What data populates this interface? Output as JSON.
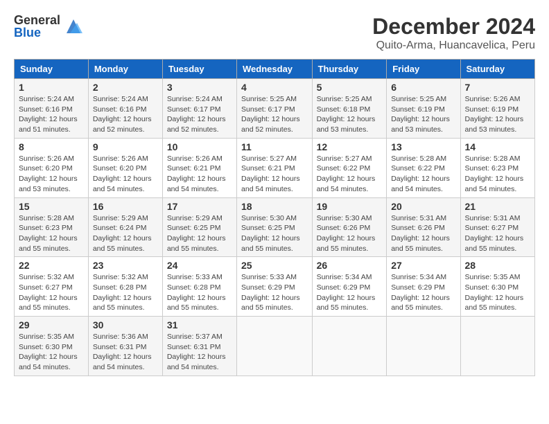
{
  "header": {
    "logo_general": "General",
    "logo_blue": "Blue",
    "title": "December 2024",
    "subtitle": "Quito-Arma, Huancavelica, Peru"
  },
  "calendar": {
    "days_of_week": [
      "Sunday",
      "Monday",
      "Tuesday",
      "Wednesday",
      "Thursday",
      "Friday",
      "Saturday"
    ],
    "weeks": [
      [
        {
          "day": "1",
          "info": "Sunrise: 5:24 AM\nSunset: 6:16 PM\nDaylight: 12 hours\nand 51 minutes."
        },
        {
          "day": "2",
          "info": "Sunrise: 5:24 AM\nSunset: 6:16 PM\nDaylight: 12 hours\nand 52 minutes."
        },
        {
          "day": "3",
          "info": "Sunrise: 5:24 AM\nSunset: 6:17 PM\nDaylight: 12 hours\nand 52 minutes."
        },
        {
          "day": "4",
          "info": "Sunrise: 5:25 AM\nSunset: 6:17 PM\nDaylight: 12 hours\nand 52 minutes."
        },
        {
          "day": "5",
          "info": "Sunrise: 5:25 AM\nSunset: 6:18 PM\nDaylight: 12 hours\nand 53 minutes."
        },
        {
          "day": "6",
          "info": "Sunrise: 5:25 AM\nSunset: 6:19 PM\nDaylight: 12 hours\nand 53 minutes."
        },
        {
          "day": "7",
          "info": "Sunrise: 5:26 AM\nSunset: 6:19 PM\nDaylight: 12 hours\nand 53 minutes."
        }
      ],
      [
        {
          "day": "8",
          "info": "Sunrise: 5:26 AM\nSunset: 6:20 PM\nDaylight: 12 hours\nand 53 minutes."
        },
        {
          "day": "9",
          "info": "Sunrise: 5:26 AM\nSunset: 6:20 PM\nDaylight: 12 hours\nand 54 minutes."
        },
        {
          "day": "10",
          "info": "Sunrise: 5:26 AM\nSunset: 6:21 PM\nDaylight: 12 hours\nand 54 minutes."
        },
        {
          "day": "11",
          "info": "Sunrise: 5:27 AM\nSunset: 6:21 PM\nDaylight: 12 hours\nand 54 minutes."
        },
        {
          "day": "12",
          "info": "Sunrise: 5:27 AM\nSunset: 6:22 PM\nDaylight: 12 hours\nand 54 minutes."
        },
        {
          "day": "13",
          "info": "Sunrise: 5:28 AM\nSunset: 6:22 PM\nDaylight: 12 hours\nand 54 minutes."
        },
        {
          "day": "14",
          "info": "Sunrise: 5:28 AM\nSunset: 6:23 PM\nDaylight: 12 hours\nand 54 minutes."
        }
      ],
      [
        {
          "day": "15",
          "info": "Sunrise: 5:28 AM\nSunset: 6:23 PM\nDaylight: 12 hours\nand 55 minutes."
        },
        {
          "day": "16",
          "info": "Sunrise: 5:29 AM\nSunset: 6:24 PM\nDaylight: 12 hours\nand 55 minutes."
        },
        {
          "day": "17",
          "info": "Sunrise: 5:29 AM\nSunset: 6:25 PM\nDaylight: 12 hours\nand 55 minutes."
        },
        {
          "day": "18",
          "info": "Sunrise: 5:30 AM\nSunset: 6:25 PM\nDaylight: 12 hours\nand 55 minutes."
        },
        {
          "day": "19",
          "info": "Sunrise: 5:30 AM\nSunset: 6:26 PM\nDaylight: 12 hours\nand 55 minutes."
        },
        {
          "day": "20",
          "info": "Sunrise: 5:31 AM\nSunset: 6:26 PM\nDaylight: 12 hours\nand 55 minutes."
        },
        {
          "day": "21",
          "info": "Sunrise: 5:31 AM\nSunset: 6:27 PM\nDaylight: 12 hours\nand 55 minutes."
        }
      ],
      [
        {
          "day": "22",
          "info": "Sunrise: 5:32 AM\nSunset: 6:27 PM\nDaylight: 12 hours\nand 55 minutes."
        },
        {
          "day": "23",
          "info": "Sunrise: 5:32 AM\nSunset: 6:28 PM\nDaylight: 12 hours\nand 55 minutes."
        },
        {
          "day": "24",
          "info": "Sunrise: 5:33 AM\nSunset: 6:28 PM\nDaylight: 12 hours\nand 55 minutes."
        },
        {
          "day": "25",
          "info": "Sunrise: 5:33 AM\nSunset: 6:29 PM\nDaylight: 12 hours\nand 55 minutes."
        },
        {
          "day": "26",
          "info": "Sunrise: 5:34 AM\nSunset: 6:29 PM\nDaylight: 12 hours\nand 55 minutes."
        },
        {
          "day": "27",
          "info": "Sunrise: 5:34 AM\nSunset: 6:29 PM\nDaylight: 12 hours\nand 55 minutes."
        },
        {
          "day": "28",
          "info": "Sunrise: 5:35 AM\nSunset: 6:30 PM\nDaylight: 12 hours\nand 55 minutes."
        }
      ],
      [
        {
          "day": "29",
          "info": "Sunrise: 5:35 AM\nSunset: 6:30 PM\nDaylight: 12 hours\nand 54 minutes."
        },
        {
          "day": "30",
          "info": "Sunrise: 5:36 AM\nSunset: 6:31 PM\nDaylight: 12 hours\nand 54 minutes."
        },
        {
          "day": "31",
          "info": "Sunrise: 5:37 AM\nSunset: 6:31 PM\nDaylight: 12 hours\nand 54 minutes."
        },
        {
          "day": "",
          "info": ""
        },
        {
          "day": "",
          "info": ""
        },
        {
          "day": "",
          "info": ""
        },
        {
          "day": "",
          "info": ""
        }
      ]
    ]
  }
}
